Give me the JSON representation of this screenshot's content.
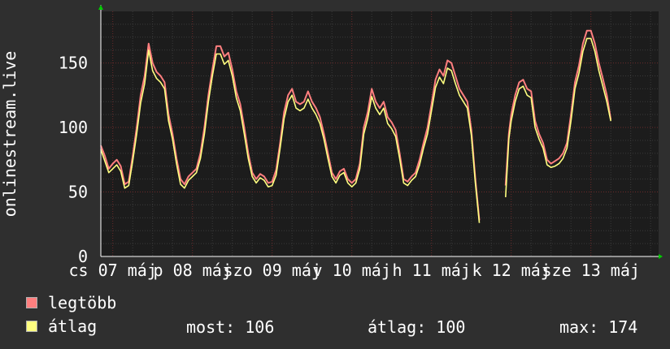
{
  "chart_data": {
    "type": "line",
    "ylabel": "onlinestream.live",
    "ylim": [
      0,
      190
    ],
    "yticks": [
      0,
      50,
      100,
      150
    ],
    "grid": true,
    "x_tick_labels": [
      "cs 07 máj",
      "p 08 máj",
      "szo 09 máj",
      "v 10 máj",
      "h 11 máj",
      "k 12 máj",
      "sze 13 máj"
    ],
    "x_tick_positions_days": [
      0,
      1,
      2,
      3,
      4,
      5,
      6
    ],
    "x_range_days": [
      -0.15,
      6.85
    ],
    "series": [
      {
        "name": "legtöbb",
        "color": "#ff7f7f",
        "points": [
          [
            -0.15,
            86
          ],
          [
            -0.1,
            78
          ],
          [
            -0.05,
            68
          ],
          [
            0,
            72
          ],
          [
            0.05,
            75
          ],
          [
            0.1,
            70
          ],
          [
            0.15,
            56
          ],
          [
            0.2,
            58
          ],
          [
            0.25,
            78
          ],
          [
            0.3,
            100
          ],
          [
            0.35,
            125
          ],
          [
            0.4,
            140
          ],
          [
            0.45,
            165
          ],
          [
            0.5,
            150
          ],
          [
            0.55,
            143
          ],
          [
            0.6,
            140
          ],
          [
            0.65,
            135
          ],
          [
            0.7,
            110
          ],
          [
            0.75,
            95
          ],
          [
            0.8,
            76
          ],
          [
            0.85,
            60
          ],
          [
            0.9,
            56
          ],
          [
            0.95,
            62
          ],
          [
            1.0,
            65
          ],
          [
            1.05,
            68
          ],
          [
            1.1,
            80
          ],
          [
            1.15,
            100
          ],
          [
            1.2,
            125
          ],
          [
            1.25,
            145
          ],
          [
            1.3,
            163
          ],
          [
            1.35,
            163
          ],
          [
            1.4,
            155
          ],
          [
            1.45,
            158
          ],
          [
            1.5,
            145
          ],
          [
            1.55,
            128
          ],
          [
            1.6,
            118
          ],
          [
            1.65,
            100
          ],
          [
            1.7,
            80
          ],
          [
            1.75,
            65
          ],
          [
            1.8,
            60
          ],
          [
            1.85,
            64
          ],
          [
            1.9,
            62
          ],
          [
            1.95,
            57
          ],
          [
            2.0,
            58
          ],
          [
            2.05,
            67
          ],
          [
            2.1,
            88
          ],
          [
            2.15,
            112
          ],
          [
            2.2,
            125
          ],
          [
            2.25,
            130
          ],
          [
            2.3,
            120
          ],
          [
            2.35,
            118
          ],
          [
            2.4,
            120
          ],
          [
            2.45,
            128
          ],
          [
            2.5,
            120
          ],
          [
            2.55,
            115
          ],
          [
            2.6,
            108
          ],
          [
            2.65,
            95
          ],
          [
            2.7,
            80
          ],
          [
            2.75,
            65
          ],
          [
            2.8,
            60
          ],
          [
            2.85,
            66
          ],
          [
            2.9,
            68
          ],
          [
            2.95,
            60
          ],
          [
            3.0,
            57
          ],
          [
            3.05,
            60
          ],
          [
            3.1,
            72
          ],
          [
            3.15,
            100
          ],
          [
            3.2,
            112
          ],
          [
            3.25,
            130
          ],
          [
            3.3,
            120
          ],
          [
            3.35,
            115
          ],
          [
            3.4,
            120
          ],
          [
            3.45,
            108
          ],
          [
            3.5,
            104
          ],
          [
            3.55,
            98
          ],
          [
            3.6,
            80
          ],
          [
            3.65,
            60
          ],
          [
            3.7,
            58
          ],
          [
            3.75,
            62
          ],
          [
            3.8,
            65
          ],
          [
            3.85,
            75
          ],
          [
            3.9,
            88
          ],
          [
            3.95,
            100
          ],
          [
            4.0,
            118
          ],
          [
            4.05,
            137
          ],
          [
            4.1,
            145
          ],
          [
            4.15,
            140
          ],
          [
            4.2,
            152
          ],
          [
            4.25,
            150
          ],
          [
            4.3,
            140
          ],
          [
            4.35,
            130
          ],
          [
            4.4,
            125
          ],
          [
            4.45,
            120
          ],
          [
            4.5,
            98
          ],
          [
            4.55,
            60
          ],
          [
            4.6,
            28
          ],
          [
            4.65,
            null
          ],
          [
            4.9,
            null
          ],
          [
            4.93,
            55
          ],
          [
            4.97,
            95
          ],
          [
            5.0,
            110
          ],
          [
            5.05,
            125
          ],
          [
            5.1,
            135
          ],
          [
            5.15,
            137
          ],
          [
            5.2,
            130
          ],
          [
            5.25,
            128
          ],
          [
            5.3,
            105
          ],
          [
            5.35,
            95
          ],
          [
            5.4,
            88
          ],
          [
            5.45,
            75
          ],
          [
            5.5,
            72
          ],
          [
            5.55,
            74
          ],
          [
            5.6,
            76
          ],
          [
            5.65,
            80
          ],
          [
            5.7,
            88
          ],
          [
            5.75,
            110
          ],
          [
            5.8,
            135
          ],
          [
            5.85,
            148
          ],
          [
            5.9,
            165
          ],
          [
            5.95,
            175
          ],
          [
            6.0,
            175
          ],
          [
            6.05,
            165
          ],
          [
            6.1,
            150
          ],
          [
            6.15,
            138
          ],
          [
            6.2,
            125
          ],
          [
            6.25,
            106
          ]
        ]
      },
      {
        "name": "átlag",
        "color": "#ffff80",
        "points": [
          [
            -0.15,
            83
          ],
          [
            -0.1,
            74
          ],
          [
            -0.05,
            65
          ],
          [
            0,
            68
          ],
          [
            0.05,
            71
          ],
          [
            0.1,
            66
          ],
          [
            0.15,
            53
          ],
          [
            0.2,
            55
          ],
          [
            0.25,
            74
          ],
          [
            0.3,
            95
          ],
          [
            0.35,
            119
          ],
          [
            0.4,
            134
          ],
          [
            0.45,
            160
          ],
          [
            0.5,
            144
          ],
          [
            0.55,
            138
          ],
          [
            0.6,
            135
          ],
          [
            0.65,
            130
          ],
          [
            0.7,
            105
          ],
          [
            0.75,
            91
          ],
          [
            0.8,
            72
          ],
          [
            0.85,
            56
          ],
          [
            0.9,
            53
          ],
          [
            0.95,
            59
          ],
          [
            1.0,
            62
          ],
          [
            1.05,
            65
          ],
          [
            1.1,
            76
          ],
          [
            1.15,
            95
          ],
          [
            1.2,
            120
          ],
          [
            1.25,
            140
          ],
          [
            1.3,
            157
          ],
          [
            1.35,
            157
          ],
          [
            1.4,
            149
          ],
          [
            1.45,
            152
          ],
          [
            1.5,
            140
          ],
          [
            1.55,
            123
          ],
          [
            1.6,
            113
          ],
          [
            1.65,
            95
          ],
          [
            1.7,
            76
          ],
          [
            1.75,
            62
          ],
          [
            1.8,
            57
          ],
          [
            1.85,
            61
          ],
          [
            1.9,
            59
          ],
          [
            1.95,
            54
          ],
          [
            2.0,
            55
          ],
          [
            2.05,
            63
          ],
          [
            2.1,
            84
          ],
          [
            2.15,
            107
          ],
          [
            2.2,
            120
          ],
          [
            2.25,
            125
          ],
          [
            2.3,
            115
          ],
          [
            2.35,
            113
          ],
          [
            2.4,
            115
          ],
          [
            2.45,
            122
          ],
          [
            2.5,
            115
          ],
          [
            2.55,
            110
          ],
          [
            2.6,
            103
          ],
          [
            2.65,
            91
          ],
          [
            2.7,
            76
          ],
          [
            2.75,
            62
          ],
          [
            2.8,
            57
          ],
          [
            2.85,
            63
          ],
          [
            2.9,
            65
          ],
          [
            2.95,
            57
          ],
          [
            3.0,
            54
          ],
          [
            3.05,
            57
          ],
          [
            3.1,
            68
          ],
          [
            3.15,
            95
          ],
          [
            3.2,
            107
          ],
          [
            3.25,
            124
          ],
          [
            3.3,
            115
          ],
          [
            3.35,
            110
          ],
          [
            3.4,
            115
          ],
          [
            3.45,
            103
          ],
          [
            3.5,
            99
          ],
          [
            3.55,
            93
          ],
          [
            3.6,
            76
          ],
          [
            3.65,
            57
          ],
          [
            3.7,
            55
          ],
          [
            3.75,
            59
          ],
          [
            3.8,
            62
          ],
          [
            3.85,
            71
          ],
          [
            3.9,
            84
          ],
          [
            3.95,
            95
          ],
          [
            4.0,
            113
          ],
          [
            4.05,
            131
          ],
          [
            4.1,
            139
          ],
          [
            4.15,
            134
          ],
          [
            4.2,
            146
          ],
          [
            4.25,
            144
          ],
          [
            4.3,
            134
          ],
          [
            4.35,
            125
          ],
          [
            4.4,
            120
          ],
          [
            4.45,
            115
          ],
          [
            4.5,
            94
          ],
          [
            4.55,
            57
          ],
          [
            4.6,
            26
          ],
          [
            4.65,
            null
          ],
          [
            4.9,
            null
          ],
          [
            4.93,
            46
          ],
          [
            4.97,
            91
          ],
          [
            5.0,
            105
          ],
          [
            5.05,
            120
          ],
          [
            5.1,
            130
          ],
          [
            5.15,
            132
          ],
          [
            5.2,
            125
          ],
          [
            5.25,
            123
          ],
          [
            5.3,
            100
          ],
          [
            5.35,
            91
          ],
          [
            5.4,
            84
          ],
          [
            5.45,
            71
          ],
          [
            5.5,
            69
          ],
          [
            5.55,
            70
          ],
          [
            5.6,
            72
          ],
          [
            5.65,
            76
          ],
          [
            5.7,
            84
          ],
          [
            5.75,
            105
          ],
          [
            5.8,
            130
          ],
          [
            5.85,
            142
          ],
          [
            5.9,
            159
          ],
          [
            5.95,
            169
          ],
          [
            6.0,
            169
          ],
          [
            6.05,
            159
          ],
          [
            6.1,
            144
          ],
          [
            6.15,
            132
          ],
          [
            6.2,
            120
          ],
          [
            6.25,
            105
          ]
        ]
      }
    ],
    "stats": {
      "current_label": "most: 106",
      "average_label": "átlag: 100",
      "max_label": "max: 174"
    }
  },
  "theme": {
    "background": "#2f2f2f",
    "plot_background": "#1c1c1c",
    "major_grid": "#6a2a2a",
    "minor_grid": "#3a3a3a",
    "axis_arrow": "#00cc00"
  }
}
